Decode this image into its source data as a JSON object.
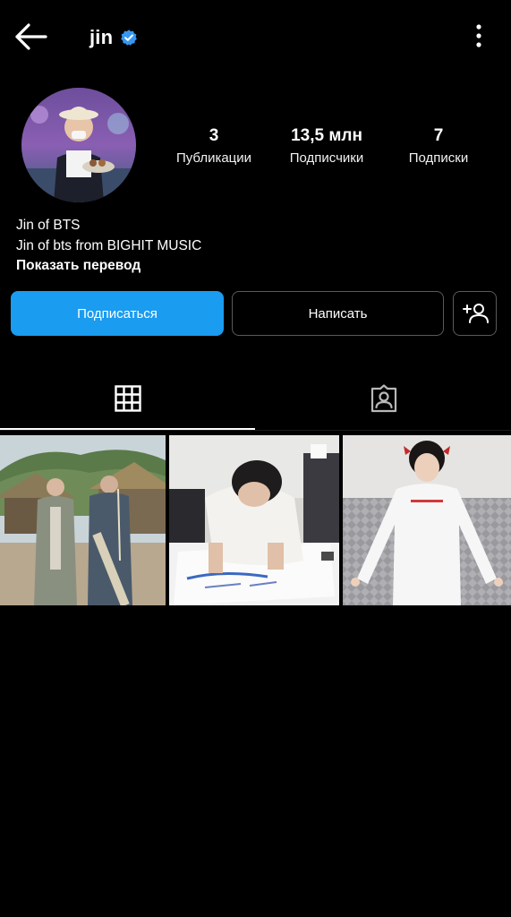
{
  "header": {
    "username": "jin",
    "back_icon": "arrow-left-icon",
    "verified_icon": "verified-badge-icon",
    "more_icon": "more-vertical-icon",
    "verified_color": "#3797f0"
  },
  "profile": {
    "avatar_icon": "profile-avatar",
    "stats": {
      "posts": {
        "value": "3",
        "label": "Публикации"
      },
      "followers": {
        "value": "13,5 млн",
        "label": "Подписчики"
      },
      "following": {
        "value": "7",
        "label": "Подписки"
      }
    }
  },
  "bio": {
    "name": "Jin of BTS",
    "text": "Jin of bts from BIGHIT MUSIC",
    "translate": "Показать перевод"
  },
  "actions": {
    "follow_label": "Подписаться",
    "message_label": "Написать",
    "add_user_icon": "add-user-icon",
    "follow_color": "#1a9cf0"
  },
  "tabs": [
    {
      "icon": "grid-icon",
      "active": true
    },
    {
      "icon": "tagged-icon",
      "active": false
    }
  ],
  "posts": [
    {
      "icon": "photo-village-two-people"
    },
    {
      "icon": "photo-man-writing-on-shirt"
    },
    {
      "icon": "photo-man-white-sweatshirt"
    }
  ]
}
